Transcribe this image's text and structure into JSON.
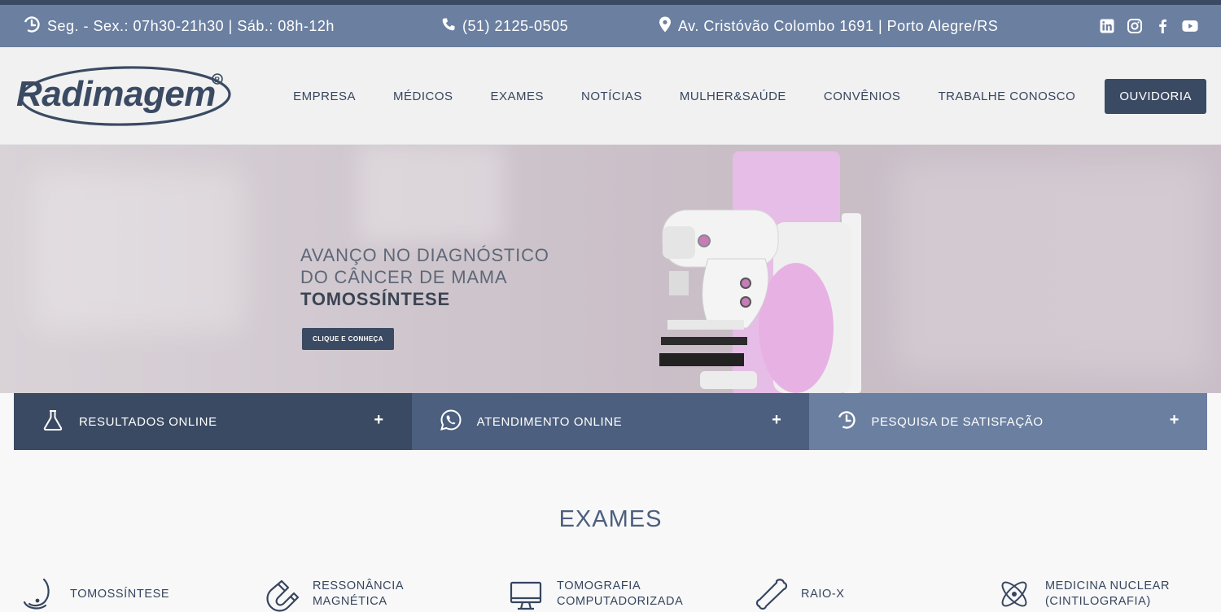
{
  "topbar": {
    "hours": "Seg. - Sex.: 07h30-21h30 | Sáb.: 08h-12h",
    "phone": "(51) 2125-0505",
    "address": "Av. Cristóvão Colombo 1691 | Porto Alegre/RS",
    "social": [
      "linkedin-icon",
      "instagram-icon",
      "facebook-icon",
      "youtube-icon"
    ]
  },
  "brand": {
    "logo_text": "Radimagem",
    "registered": "®"
  },
  "nav": {
    "items": [
      "EMPRESA",
      "MÉDICOS",
      "EXAMES",
      "NOTÍCIAS",
      "MULHER&SAÚDE",
      "CONVÊNIOS",
      "TRABALHE CONOSCO"
    ],
    "cta": "OUVIDORIA"
  },
  "hero": {
    "line1": "AVANÇO NO DIAGNÓSTICO",
    "line2": "DO CÂNCER DE MAMA",
    "line3": "TOMOSSÍNTESE",
    "button": "CLIQUE E CONHEÇA"
  },
  "quick_links": [
    {
      "label": "RESULTADOS ONLINE",
      "icon": "flask-icon"
    },
    {
      "label": "ATENDIMENTO ONLINE",
      "icon": "whatsapp-icon"
    },
    {
      "label": "PESQUISA DE SATISFAÇÃO",
      "icon": "clock-icon"
    }
  ],
  "plus": "+",
  "exams": {
    "title": "EXAMES",
    "items": [
      {
        "line1": "TOMOSSÍNTESE",
        "line2": "",
        "icon": "breast-icon"
      },
      {
        "line1": "RESSONÂNCIA",
        "line2": "MAGNÉTICA",
        "icon": "magnet-icon"
      },
      {
        "line1": "TOMOGRAFIA",
        "line2": "COMPUTADORIZADA",
        "icon": "monitor-icon"
      },
      {
        "line1": "RAIO-X",
        "line2": "",
        "icon": "bone-icon"
      },
      {
        "line1": "MEDICINA NUCLEAR",
        "line2": "(CINTILOGRAFIA)",
        "icon": "atom-icon"
      }
    ]
  },
  "colors": {
    "dark": "#3b4a63",
    "mid": "#4c5f7f",
    "light": "#6b7fa0",
    "text": "#36455f"
  }
}
